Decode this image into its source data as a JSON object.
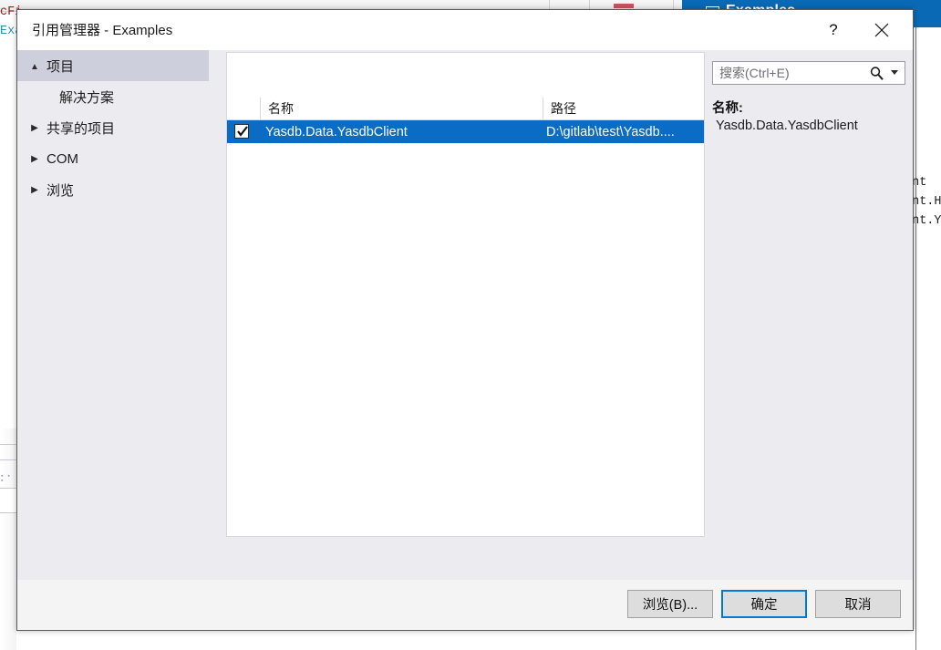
{
  "background": {
    "window_title": "Examples",
    "window_title_icon": "window-icon",
    "code_right": [
      "ent",
      "ent.H",
      "ent.Y"
    ],
    "code_left": [
      "cFi",
      "Exa"
    ]
  },
  "dialog": {
    "title": "引用管理器 - Examples",
    "help_label": "?",
    "close_label": "✕",
    "tree": {
      "items": [
        {
          "label": "项目",
          "glyph": "▲",
          "state": "expanded",
          "selected": true,
          "child": false
        },
        {
          "label": "解决方案",
          "glyph": "",
          "state": "leaf",
          "selected": false,
          "child": true
        },
        {
          "label": "共享的项目",
          "glyph": "▶",
          "state": "collapsed",
          "selected": false,
          "child": false
        },
        {
          "label": "COM",
          "glyph": "▶",
          "state": "collapsed",
          "selected": false,
          "child": false
        },
        {
          "label": "浏览",
          "glyph": "▶",
          "state": "collapsed",
          "selected": false,
          "child": false
        }
      ]
    },
    "list": {
      "columns": [
        "",
        "名称",
        "路径"
      ],
      "rows": [
        {
          "checked": true,
          "name": "Yasdb.Data.YasdbClient",
          "path": "D:\\gitlab\\test\\Yasdb....",
          "selected": true
        }
      ]
    },
    "search": {
      "placeholder": "搜索(Ctrl+E)",
      "value": "",
      "icon": "search-icon",
      "dropdown_icon": "chevron-down-icon"
    },
    "detail": {
      "name_label": "名称:",
      "name_value": "Yasdb.Data.YasdbClient"
    },
    "footer": {
      "browse_label": "浏览(B)...",
      "ok_label": "确定",
      "cancel_label": "取消"
    },
    "colors": {
      "accent": "#0a6cc4",
      "title_bar_blue": "#0a69b4",
      "default_button_border": "#0078d7",
      "tree_selection": "#cdd0dc"
    }
  }
}
